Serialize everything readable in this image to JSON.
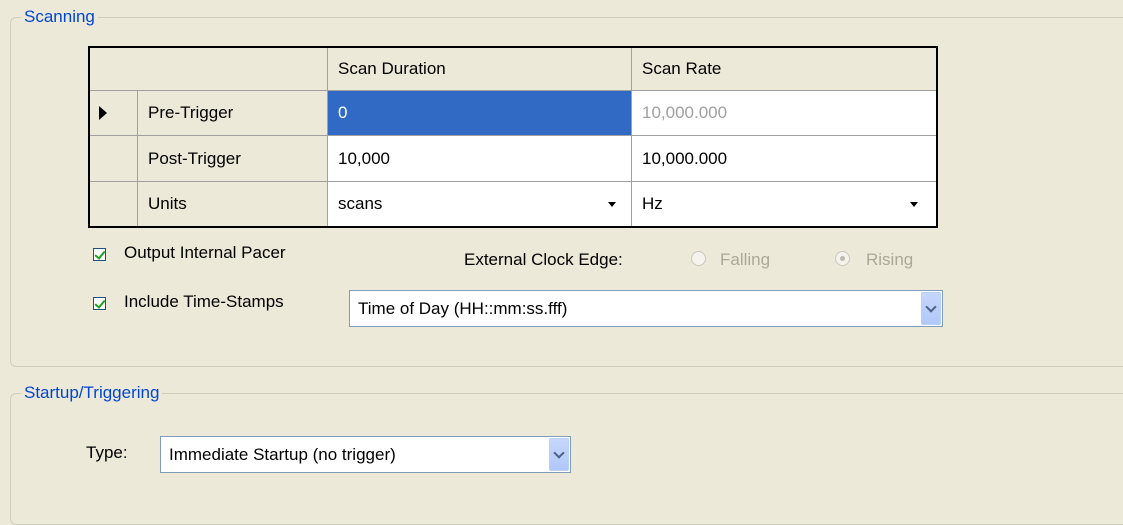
{
  "scanning": {
    "legend": "Scanning",
    "grid": {
      "headers": [
        "Scan Duration",
        "Scan Rate"
      ],
      "rows": [
        {
          "label": "Pre-Trigger",
          "duration": "0",
          "rate": "10,000.000"
        },
        {
          "label": "Post-Trigger",
          "duration": "10,000",
          "rate": "10,000.000"
        },
        {
          "label": "Units",
          "duration": "scans",
          "rate": "Hz"
        }
      ]
    },
    "output_internal_pacer": {
      "label": "Output Internal Pacer",
      "checked": true
    },
    "external_clock_edge": {
      "label": "External Clock Edge:",
      "options": [
        "Falling",
        "Rising"
      ],
      "selected": "Rising"
    },
    "include_time_stamps": {
      "label": "Include Time-Stamps",
      "checked": true
    },
    "timestamp_format": {
      "value": "Time of Day (HH::mm:ss.fff)"
    }
  },
  "startup": {
    "legend": "Startup/Triggering",
    "type_label": "Type:",
    "type_value": "Immediate Startup (no trigger)"
  },
  "colors": {
    "legend_blue": "#0046d5",
    "selection_blue": "#316ac5",
    "background": "#ece9d8"
  }
}
